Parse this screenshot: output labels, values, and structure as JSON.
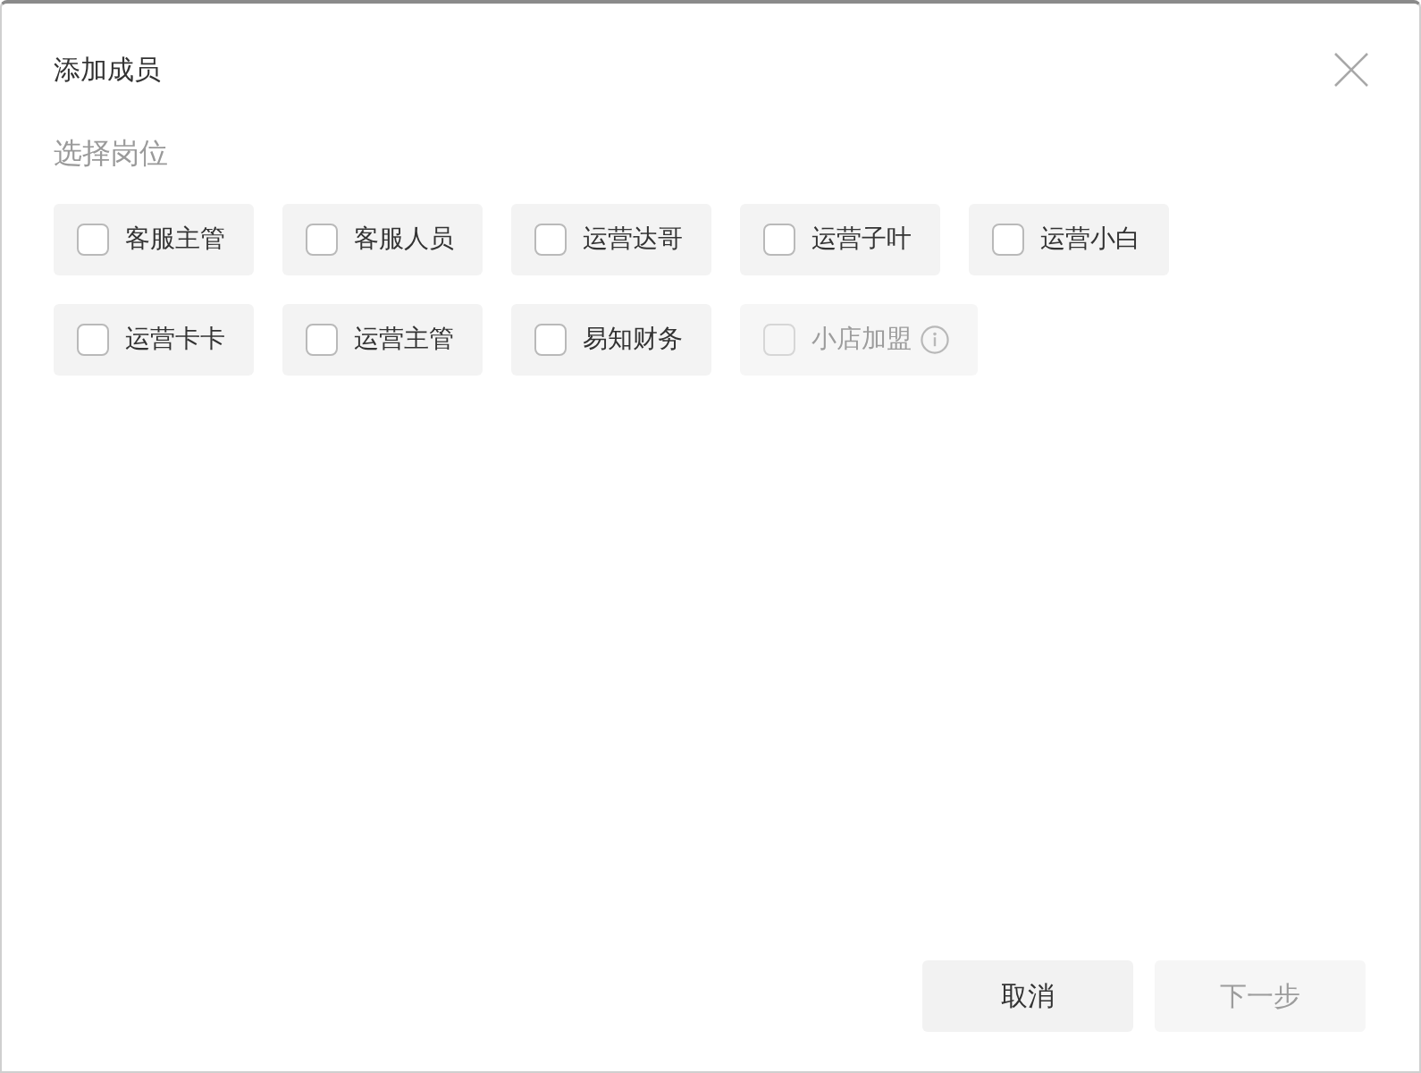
{
  "dialog": {
    "title": "添加成员",
    "section_label": "选择岗位",
    "roles": [
      {
        "label": "客服主管",
        "checked": false,
        "disabled": false,
        "info": false
      },
      {
        "label": "客服人员",
        "checked": false,
        "disabled": false,
        "info": false
      },
      {
        "label": "运营达哥",
        "checked": false,
        "disabled": false,
        "info": false
      },
      {
        "label": "运营子叶",
        "checked": false,
        "disabled": false,
        "info": false
      },
      {
        "label": "运营小白",
        "checked": false,
        "disabled": false,
        "info": false
      },
      {
        "label": "运营卡卡",
        "checked": false,
        "disabled": false,
        "info": false
      },
      {
        "label": "运营主管",
        "checked": false,
        "disabled": false,
        "info": false
      },
      {
        "label": "易知财务",
        "checked": false,
        "disabled": false,
        "info": false
      },
      {
        "label": "小店加盟",
        "checked": false,
        "disabled": true,
        "info": true
      }
    ],
    "buttons": [
      {
        "label": "取消",
        "disabled": false
      },
      {
        "label": "下一步",
        "disabled": true
      }
    ]
  }
}
